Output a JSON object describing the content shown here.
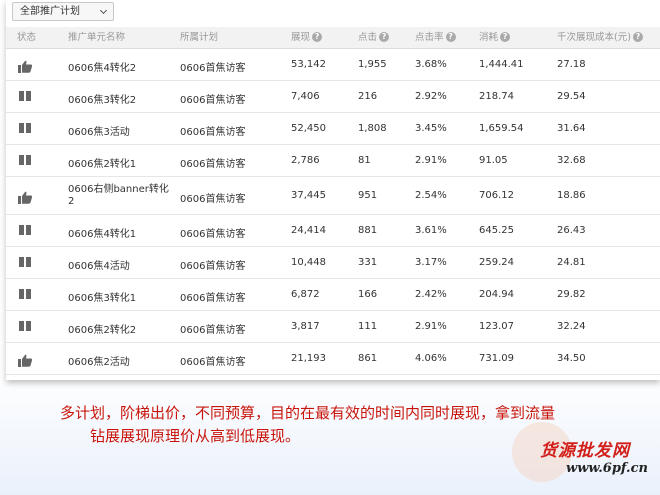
{
  "filter": {
    "label": "全部推广计划"
  },
  "columns": {
    "status": "状态",
    "unit_name": "推广单元名称",
    "plan": "所属计划",
    "impressions": "展现",
    "clicks": "点击",
    "ctr": "点击率",
    "cost": "消耗",
    "cpm": "千次展现成本(元)"
  },
  "rows": [
    {
      "status": "active",
      "name": "0606焦4转化2",
      "plan": "0606首焦访客",
      "impressions": "53,142",
      "clicks": "1,955",
      "ctr": "3.68%",
      "cost": "1,444.41",
      "cpm": "27.18"
    },
    {
      "status": "paused",
      "name": "0606焦3转化2",
      "plan": "0606首焦访客",
      "impressions": "7,406",
      "clicks": "216",
      "ctr": "2.92%",
      "cost": "218.74",
      "cpm": "29.54"
    },
    {
      "status": "paused",
      "name": "0606焦3活动",
      "plan": "0606首焦访客",
      "impressions": "52,450",
      "clicks": "1,808",
      "ctr": "3.45%",
      "cost": "1,659.54",
      "cpm": "31.64"
    },
    {
      "status": "paused",
      "name": "0606焦2转化1",
      "plan": "0606首焦访客",
      "impressions": "2,786",
      "clicks": "81",
      "ctr": "2.91%",
      "cost": "91.05",
      "cpm": "32.68"
    },
    {
      "status": "active",
      "name": "0606右侧banner转化2",
      "plan": "0606首焦访客",
      "impressions": "37,445",
      "clicks": "951",
      "ctr": "2.54%",
      "cost": "706.12",
      "cpm": "18.86"
    },
    {
      "status": "paused",
      "name": "0606焦4转化1",
      "plan": "0606首焦访客",
      "impressions": "24,414",
      "clicks": "881",
      "ctr": "3.61%",
      "cost": "645.25",
      "cpm": "26.43"
    },
    {
      "status": "paused",
      "name": "0606焦4活动",
      "plan": "0606首焦访客",
      "impressions": "10,448",
      "clicks": "331",
      "ctr": "3.17%",
      "cost": "259.24",
      "cpm": "24.81"
    },
    {
      "status": "paused",
      "name": "0606焦3转化1",
      "plan": "0606首焦访客",
      "impressions": "6,872",
      "clicks": "166",
      "ctr": "2.42%",
      "cost": "204.94",
      "cpm": "29.82"
    },
    {
      "status": "paused",
      "name": "0606焦2转化2",
      "plan": "0606首焦访客",
      "impressions": "3,817",
      "clicks": "111",
      "ctr": "2.91%",
      "cost": "123.07",
      "cpm": "32.24"
    },
    {
      "status": "active",
      "name": "0606焦2活动",
      "plan": "0606首焦访客",
      "impressions": "21,193",
      "clicks": "861",
      "ctr": "4.06%",
      "cost": "731.09",
      "cpm": "34.50"
    }
  ],
  "caption": {
    "line1": "多计划，阶梯出价，不同预算，目的在最有效的时间内同时展现，拿到流量",
    "line2": "钻展展现原理价从高到低展现。"
  },
  "watermark": {
    "name": "货源批发网",
    "url": "www.6pf.cn"
  },
  "colors": {
    "caption": "#c8150b",
    "header_bg": "#f2f2f2",
    "header_text": "#999999",
    "icon": "#666666"
  },
  "icons": {
    "active": "thumbs-up-icon",
    "paused": "pause-icon",
    "help": "question-icon"
  }
}
